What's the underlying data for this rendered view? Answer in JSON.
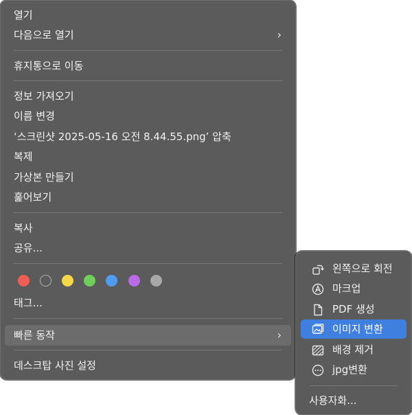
{
  "main_menu": {
    "items": [
      {
        "label": "열기"
      },
      {
        "label": "다음으로 열기"
      },
      {
        "label": "휴지통으로 이동"
      },
      {
        "label": "정보 가져오기"
      },
      {
        "label": "이름 변경"
      },
      {
        "label": "‘스크린샷 2025-05-16 오전 8.44.55.png’ 압축"
      },
      {
        "label": "복제"
      },
      {
        "label": "가상본 만들기"
      },
      {
        "label": "훑어보기"
      },
      {
        "label": "복사"
      },
      {
        "label": "공유..."
      },
      {
        "label": "태그..."
      },
      {
        "label": "빠른 동작"
      },
      {
        "label": "데스크탑 사진 설정"
      }
    ],
    "submenu_chevron": "›",
    "tag_colors": [
      {
        "name": "red",
        "color": "#ee5e55"
      },
      {
        "name": "none",
        "color": "transparent"
      },
      {
        "name": "yellow",
        "color": "#f4d84a"
      },
      {
        "name": "green",
        "color": "#6fcf5a"
      },
      {
        "name": "blue",
        "color": "#4f9cf0"
      },
      {
        "name": "purple",
        "color": "#b96ae6"
      },
      {
        "name": "gray",
        "color": "#a8a8a8"
      }
    ]
  },
  "quick_actions_submenu": {
    "items": [
      {
        "label": "왼쪽으로 회전",
        "icon": "rotate-left-icon"
      },
      {
        "label": "마크업",
        "icon": "markup-icon"
      },
      {
        "label": "PDF 생성",
        "icon": "document-icon"
      },
      {
        "label": "이미지 변환",
        "icon": "image-convert-icon"
      },
      {
        "label": "배경 제거",
        "icon": "remove-background-icon"
      },
      {
        "label": "jpg변환",
        "icon": "more-icon"
      },
      {
        "label": "사용자화..."
      }
    ],
    "highlight_color": "#3f7fe0"
  }
}
